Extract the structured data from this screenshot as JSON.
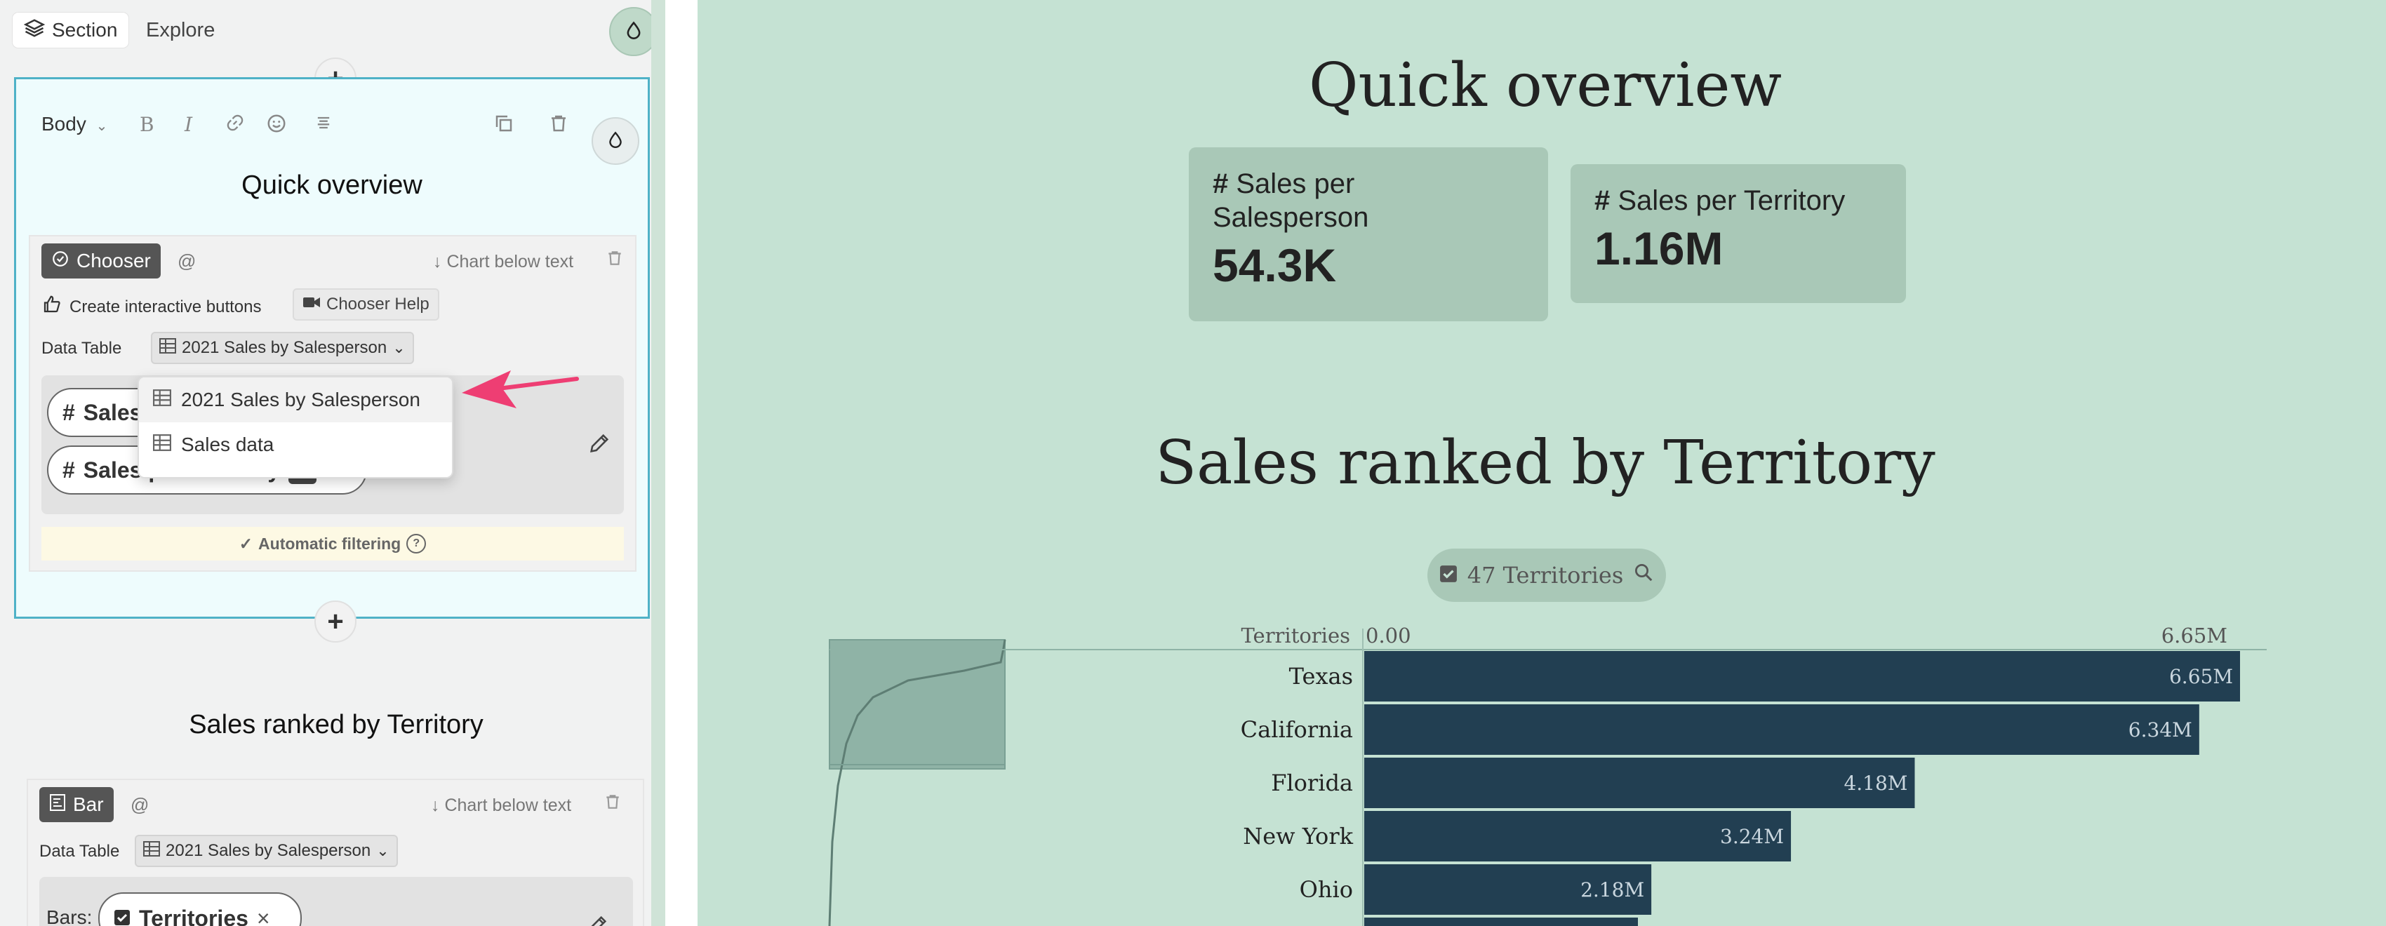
{
  "left_panel": {
    "tabs": {
      "section": "Section",
      "explore": "Explore"
    },
    "editor": {
      "text_style": "Body",
      "heading": "Quick overview",
      "chooser": {
        "badge": "Chooser",
        "at": "@",
        "position": "Chart below text",
        "create_buttons": "Create interactive buttons",
        "help": "Chooser Help",
        "data_table_label": "Data Table",
        "data_table_value": "2021 Sales by Salesperson",
        "items": [
          "Sales per Salesperson",
          "Sales per Territory"
        ],
        "item1_visible": "Sales",
        "item2_visible": "Sales per Territory",
        "auto_filtering": "Automatic filtering",
        "dropdown_options": [
          "2021 Sales by Salesperson",
          "Sales data"
        ]
      }
    },
    "block2": {
      "heading": "Sales ranked by Territory",
      "badge": "Bar",
      "at": "@",
      "position": "Chart below text",
      "data_table_label": "Data Table",
      "data_table_value": "2021 Sales by Salesperson",
      "bars_label": "Bars:",
      "bars_value": "Territories"
    }
  },
  "canvas": {
    "title": "Quick overview",
    "kpis": [
      {
        "label_line1": "Sales per",
        "label_line2": "Salesperson",
        "value": "54.3K"
      },
      {
        "label_line1": "Sales per Territory",
        "label_line2": "",
        "value": "1.16M"
      }
    ],
    "section_title": "Sales ranked by Territory",
    "filter_label": "47 Territories"
  },
  "chart_data": {
    "type": "bar",
    "orientation": "horizontal",
    "xlabel": "",
    "ylabel": "Territories",
    "x_ticks": [
      "0.00",
      "6.65M"
    ],
    "xlim": [
      0,
      6.65
    ],
    "categories": [
      "Texas",
      "California",
      "Florida",
      "New York",
      "Ohio"
    ],
    "values": [
      6.65,
      6.34,
      4.18,
      3.24,
      2.18
    ],
    "value_labels": [
      "6.65M",
      "6.34M",
      "4.18M",
      "3.24M",
      "2.18M"
    ],
    "unit": "M",
    "bar_color": "#223f52",
    "label_color": "#c9d6de"
  },
  "colors": {
    "canvas_bg": "#c5e2d3",
    "accent_border": "#4fb2c7",
    "arrow": "#ee3e73"
  }
}
